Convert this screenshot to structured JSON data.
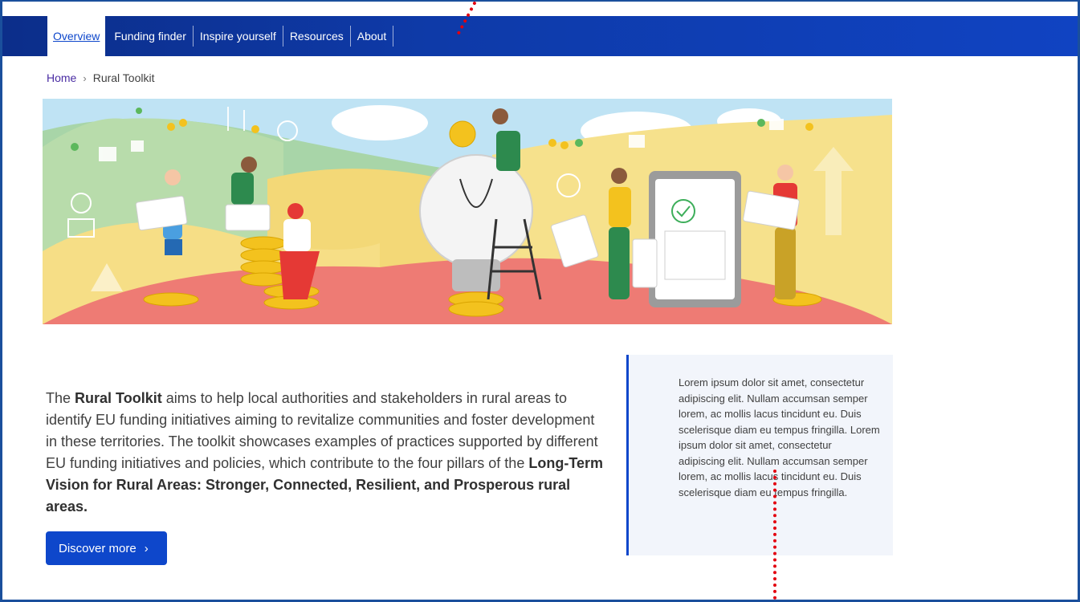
{
  "nav": {
    "items": [
      {
        "label": "Overview",
        "active": true
      },
      {
        "label": "Funding finder"
      },
      {
        "label": "Inspire yourself"
      },
      {
        "label": "Resources"
      },
      {
        "label": "About"
      }
    ]
  },
  "breadcrumb": {
    "home": "Home",
    "separator": "›",
    "current": "Rural Toolkit"
  },
  "intro": {
    "p1": "The ",
    "p1_bold": "Rural Toolkit",
    "p2": " aims to help local authorities and stakeholders in rural areas to identify EU funding initiatives aiming to revitalize communities and foster development in these territories. The toolkit showcases examples of practices supported by different EU funding initiatives and policies, which contribute to the four pillars of the ",
    "p2_bold": "Long-Term Vision for Rural Areas: Stronger, Connected, Resilient, and Prosperous rural areas."
  },
  "cta": {
    "label": "Discover more",
    "chevron": "›"
  },
  "callout": {
    "text": "Lorem ipsum dolor sit amet, consectetur adipiscing elit. Nullam accumsan semper lorem, ac mollis lacus tincidunt eu. Duis scelerisque diam eu tempus fringilla. Lorem ipsum dolor sit amet, consectetur adipiscing elit. Nullam accumsan semper lorem, ac mollis lacus tincidunt eu. Duis scelerisque diam eu tempus fringilla."
  },
  "colors": {
    "nav_blue": "#0e3aa8",
    "primary_blue": "#0e47cb",
    "annotation_red": "#e3000f"
  }
}
